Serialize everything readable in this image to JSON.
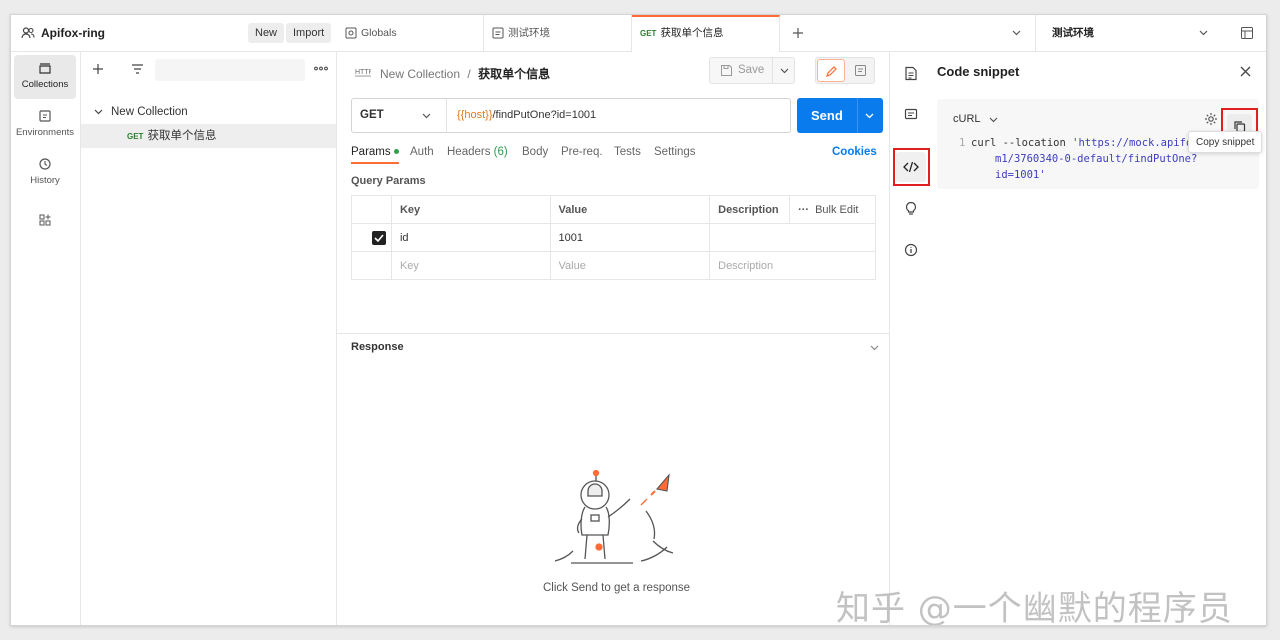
{
  "workspace": {
    "name": "Apifox-ring",
    "new_label": "New",
    "import_label": "Import"
  },
  "nav": [
    {
      "label": "Collections",
      "icon": "collections-icon"
    },
    {
      "label": "Environments",
      "icon": "environments-icon"
    },
    {
      "label": "History",
      "icon": "history-icon"
    },
    {
      "label": "",
      "icon": "apps-icon"
    }
  ],
  "tree": {
    "collection": "New Collection",
    "request_method": "GET",
    "request_name": "获取单个信息"
  },
  "tabs": [
    {
      "label": "Globals",
      "icon": "globals-icon"
    },
    {
      "label": "测试环境",
      "icon": "environment-icon"
    },
    {
      "method": "GET",
      "label": "获取单个信息"
    }
  ],
  "environment_selector": "测试环境",
  "request": {
    "breadcrumb_parent": "New Collection",
    "breadcrumb_sep": "/",
    "breadcrumb_current": "获取单个信息",
    "save_label": "Save",
    "method": "GET",
    "url_var": "{{host}}",
    "url_path": "/findPutOne?id=1001",
    "send_label": "Send",
    "tabs": [
      "Params",
      "Auth",
      "Headers",
      "Body",
      "Pre-req.",
      "Tests",
      "Settings"
    ],
    "headers_count": "(6)",
    "cookies_label": "Cookies",
    "query_params_title": "Query Params",
    "table_headers": {
      "key": "Key",
      "value": "Value",
      "description": "Description",
      "bulk_edit": "Bulk Edit"
    },
    "params": [
      {
        "checked": true,
        "key": "id",
        "value": "1001",
        "description": ""
      }
    ],
    "placeholders": {
      "key": "Key",
      "value": "Value",
      "description": "Description"
    }
  },
  "response": {
    "title": "Response",
    "hint": "Click Send to get a response"
  },
  "code_snippet": {
    "title": "Code snippet",
    "language": "cURL",
    "line_number": "1",
    "line1_cmd": "curl --location ",
    "line1_str": "'https://mock.apifo",
    "line2_str": "m1/3760340-0-default/findPutOne?",
    "line3_str": "id=1001'",
    "tooltip": "Copy snippet"
  },
  "watermark": "知乎 @一个幽默的程序员",
  "colors": {
    "accent": "#ff6c37",
    "send": "#097bed",
    "highlight_box": "#e02020",
    "url_var": "#e07b1a"
  }
}
